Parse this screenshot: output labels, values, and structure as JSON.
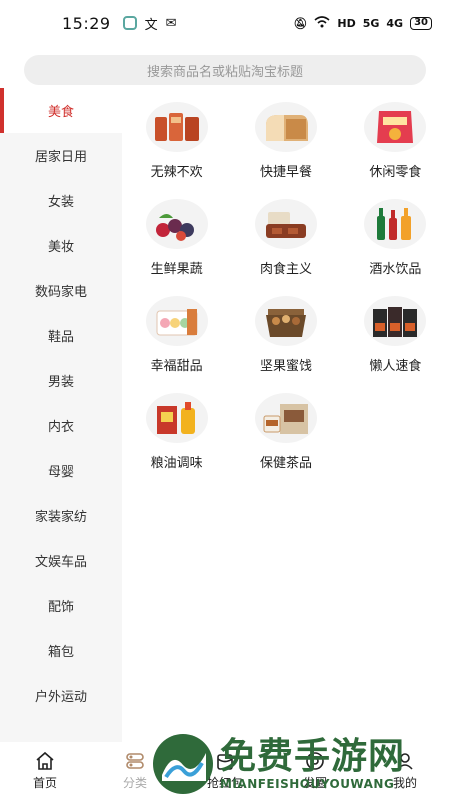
{
  "status_bar": {
    "time": "15:29",
    "lang_glyph": "文",
    "chat_glyph": "✉",
    "net1": "HD",
    "net2": "5G",
    "net3": "4G",
    "battery": "30"
  },
  "search": {
    "placeholder": "搜索商品名或粘贴淘宝标题"
  },
  "sidebar": {
    "items": [
      {
        "label": "美食",
        "active": true
      },
      {
        "label": "居家日用"
      },
      {
        "label": "女装"
      },
      {
        "label": "美妆"
      },
      {
        "label": "数码家电"
      },
      {
        "label": "鞋品"
      },
      {
        "label": "男装"
      },
      {
        "label": "内衣"
      },
      {
        "label": "母婴"
      },
      {
        "label": "家装家纺"
      },
      {
        "label": "文娱车品"
      },
      {
        "label": "配饰"
      },
      {
        "label": "箱包"
      },
      {
        "label": "户外运动"
      }
    ]
  },
  "subcategories": [
    {
      "label": "无辣不欢",
      "icon": "spicy-meat-icon"
    },
    {
      "label": "快捷早餐",
      "icon": "bread-icon"
    },
    {
      "label": "休闲零食",
      "icon": "snack-bag-icon"
    },
    {
      "label": "生鲜果蔬",
      "icon": "fruit-icon"
    },
    {
      "label": "肉食主义",
      "icon": "meat-icon"
    },
    {
      "label": "酒水饮品",
      "icon": "bottle-icon"
    },
    {
      "label": "幸福甜品",
      "icon": "macaron-icon"
    },
    {
      "label": "坚果蜜饯",
      "icon": "nut-box-icon"
    },
    {
      "label": "懒人速食",
      "icon": "noodle-pack-icon"
    },
    {
      "label": "粮油调味",
      "icon": "oil-rice-icon"
    },
    {
      "label": "保健茶品",
      "icon": "tea-box-icon"
    }
  ],
  "bottom_nav": {
    "items": [
      {
        "label": "首页",
        "icon": "home-icon"
      },
      {
        "label": "分类",
        "icon": "category-icon"
      },
      {
        "label": "抢红包",
        "icon": "red-packet-icon"
      },
      {
        "label": "发圈",
        "icon": "circle-icon"
      },
      {
        "label": "我的",
        "icon": "profile-icon"
      }
    ]
  },
  "watermark": {
    "cn": "免费手游网",
    "en": "MIANFEISHOUYOUWANG"
  },
  "colors": {
    "accent": "#d0312d",
    "sidebar_bg": "#f6f6f6",
    "watermark": "#2f6a3a"
  }
}
